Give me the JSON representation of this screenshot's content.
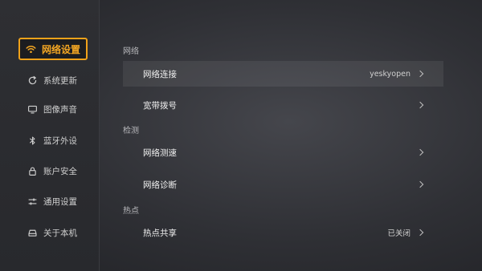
{
  "sidebar": {
    "items": [
      {
        "label": "网络设置",
        "icon": "wifi-icon",
        "active": true
      },
      {
        "label": "系统更新",
        "icon": "refresh-icon"
      },
      {
        "label": "图像声音",
        "icon": "monitor-icon"
      },
      {
        "label": "蓝牙外设",
        "icon": "bluetooth-icon"
      },
      {
        "label": "账户安全",
        "icon": "lock-icon"
      },
      {
        "label": "通用设置",
        "icon": "sliders-icon"
      },
      {
        "label": "关于本机",
        "icon": "device-icon"
      }
    ]
  },
  "main": {
    "sections": [
      {
        "title": "网络",
        "rows": [
          {
            "label": "网络连接",
            "value": "yeskyopen"
          },
          {
            "label": "宽带拨号",
            "value": ""
          }
        ]
      },
      {
        "title": "检测",
        "rows": [
          {
            "label": "网络测速",
            "value": ""
          },
          {
            "label": "网络诊断",
            "value": ""
          }
        ]
      },
      {
        "title": "热点",
        "rows": [
          {
            "label": "热点共享",
            "value": "已关闭"
          }
        ]
      }
    ]
  },
  "colors": {
    "accent": "#f0a21a"
  }
}
